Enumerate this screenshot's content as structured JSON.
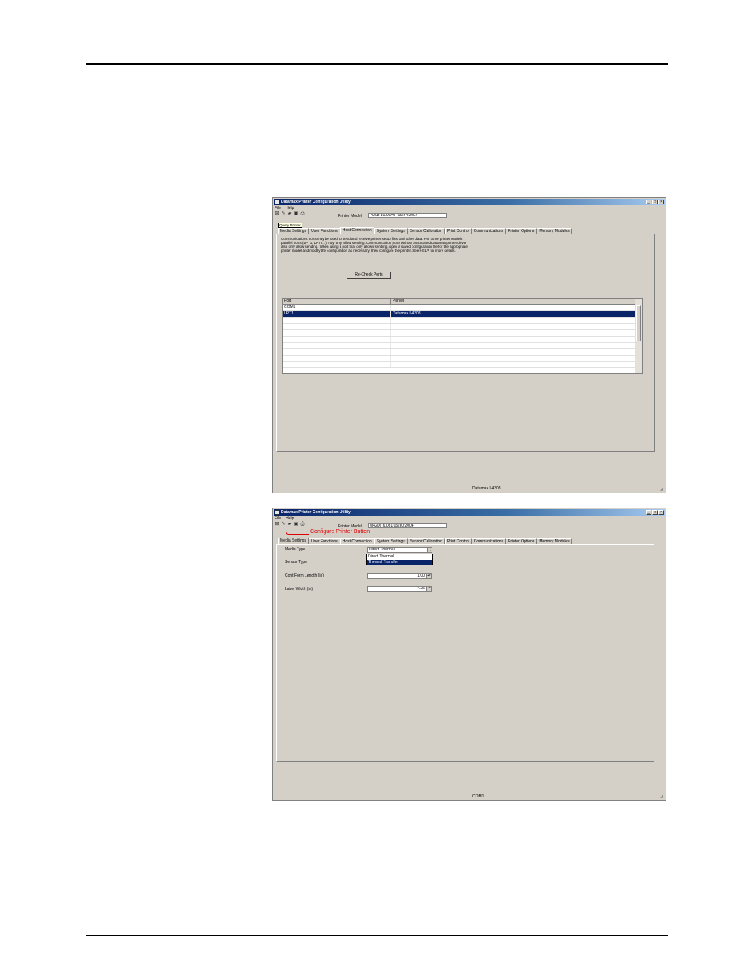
{
  "screen1": {
    "window_title": "Datamax Printer Configuration Utility",
    "menu": [
      "File",
      "Help"
    ],
    "printer_model_label": "Printer Model:",
    "printer_model_value": "I4208 10.00A/F 05/24/2007",
    "tooltip": "Query Printer",
    "tabs": [
      "Media Settings",
      "User Functions",
      "Host Connection",
      "System Settings",
      "Sensor Calibration",
      "Print Control",
      "Communications",
      "Printer Options",
      "Memory Modules"
    ],
    "active_tab": 2,
    "description": "Communications ports may be used to send and receive printer setup files and other data. For some printer models parallel ports (LPT1, LPT2...) may only allow sending. Communication ports with an associated Datamax printer driver also only allow sending. When using a port that only allows sending, open a saved configuration file for the appropriate printer model and modify the configuration as necessary, then configure the printer. See HELP for more details.",
    "recheck_button": "Re-Check Ports",
    "columns": [
      "Port",
      "Printer"
    ],
    "rows": [
      {
        "port": "COM1",
        "printer": ""
      },
      {
        "port": "LPT1",
        "printer": "Datamax I-4208"
      }
    ],
    "status": "Datamax I-4208"
  },
  "screen2": {
    "window_title": "Datamax Printer Configuration Utility",
    "menu": [
      "File",
      "Help"
    ],
    "printer_model_label": "Printer Model:",
    "printer_model_value": "M4206 6.081 05/30/2004",
    "callout": "Configure Printer Button",
    "tabs": [
      "Media Settings",
      "User Functions",
      "Host Connection",
      "System Settings",
      "Sensor Calibration",
      "Print Control",
      "Communications",
      "Printer Options",
      "Memory Modules"
    ],
    "active_tab": 0,
    "media_type_label": "Media Type",
    "media_type_value": "Direct Thermal",
    "media_type_options": [
      "Direct Thermal",
      "Thermal Transfer"
    ],
    "sensor_type_label": "Sensor Type",
    "cont_form_label": "Cont Form Length (in)",
    "cont_form_value": "1.00",
    "label_width_label": "Label Width (in)",
    "label_width_value": "4.26",
    "status": "COM1"
  }
}
